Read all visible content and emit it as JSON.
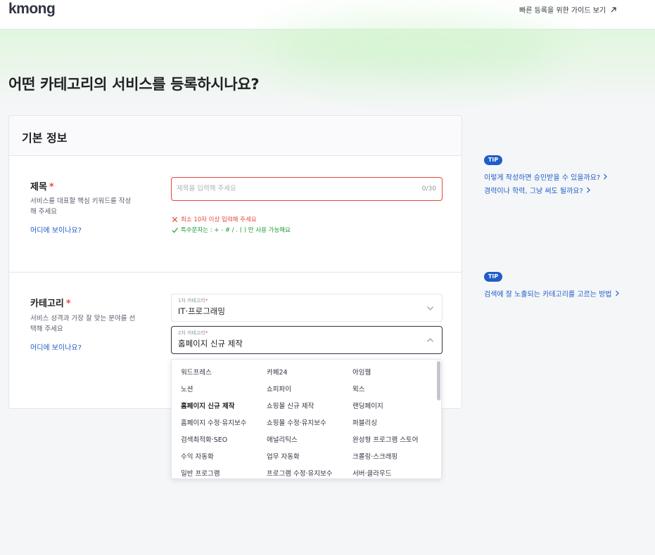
{
  "header": {
    "logo": "kmong",
    "guide_link": "빠른 등록을 위한 가이드 보기"
  },
  "page_title": "어떤 카테고리의 서비스를 등록하시나요?",
  "card": {
    "title": "기본 정보",
    "title_field": {
      "label": "제목",
      "required_mark": "*",
      "description": "서비스를 대표할 핵심 키워드를 작성해 주세요",
      "where_link": "어디에 보이나요?",
      "placeholder": "제목을 입력해 주세요",
      "value": "",
      "counter": "0/30",
      "error_message": "최소 10자 이상 입력해 주세요",
      "ok_message": "특수문자는 : + - # / . ( ) 만 사용 가능해요"
    },
    "category_field": {
      "label": "카테고리",
      "required_mark": "*",
      "description": "서비스 성격과 가장 잘 맞는 분야를 선택해 주세요",
      "where_link": "어디에 보이나요?",
      "first": {
        "small_label": "1차 카테고리",
        "value": "IT·프로그래밍"
      },
      "second": {
        "small_label": "2차 카테고리",
        "value": "홈페이지 신규 제작"
      }
    }
  },
  "dropdown": {
    "options": [
      "워드프레스",
      "카페24",
      "아임웹",
      "노션",
      "쇼피파이",
      "윅스",
      "홈페이지 신규 제작",
      "쇼핑몰 신규 제작",
      "랜딩페이지",
      "홈페이지 수정·유지보수",
      "쇼핑몰 수정·유지보수",
      "퍼블리싱",
      "검색최적화·SEO",
      "애널리틱스",
      "완성형 프로그램 스토어",
      "수익 자동화",
      "업무 자동화",
      "크롤링·스크래핑",
      "일반 프로그램",
      "프로그램 수정·유지보수",
      "서버·클라우드"
    ],
    "selected": "홈페이지 신규 제작"
  },
  "tips": {
    "badge": "TIP",
    "title_tips": [
      "이렇게 작성하면 승인받을 수 있을까요?",
      "경력이나 학력, 그냥 써도 될까요?"
    ],
    "category_tips": [
      "검색에 잘 노출되는 카테고리를 고르는 방법"
    ]
  },
  "colors": {
    "accent_blue": "#1f5dc8",
    "error_red": "#e8453c",
    "success_green": "#1f9a37",
    "required_red": "#f1464c"
  }
}
